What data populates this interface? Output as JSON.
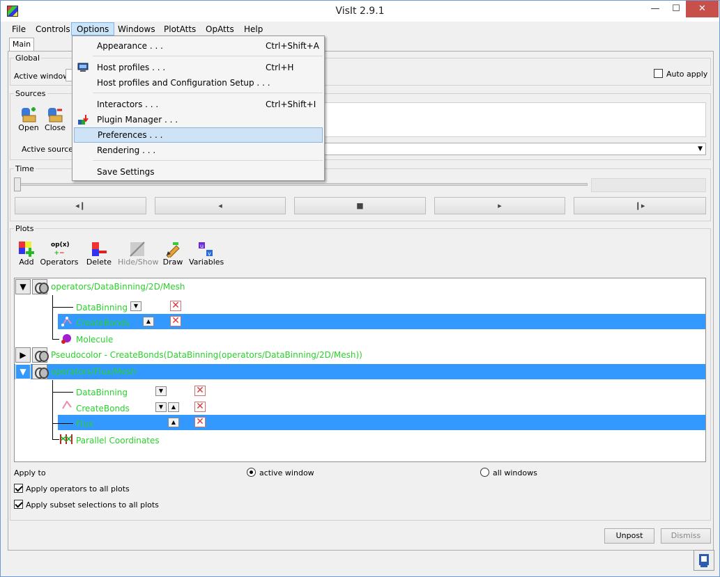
{
  "window": {
    "title": "VisIt 2.9.1",
    "minimize": "—",
    "maximize": "☐",
    "close": "✕"
  },
  "menubar": [
    "File",
    "Controls",
    "Options",
    "Windows",
    "PlotAtts",
    "OpAtts",
    "Help"
  ],
  "tabs": {
    "main": "Main"
  },
  "global": {
    "title": "Global",
    "active_window_label": "Active window",
    "auto_apply_label": "Auto apply",
    "auto_apply_checked": false
  },
  "sources": {
    "title": "Sources",
    "open_label": "Open",
    "close_label": "Close",
    "active_source_label": "Active source",
    "active_source_value": ""
  },
  "time": {
    "title": "Time",
    "controls": [
      "◂❙",
      "◂",
      "■",
      "▸",
      "❙▸"
    ]
  },
  "plots": {
    "title": "Plots",
    "toolbar": {
      "add": "Add",
      "operators": "Operators",
      "delete": "Delete",
      "hide_show": "Hide/Show",
      "draw": "Draw",
      "variables": "Variables",
      "operators_icon_text": "op(x)"
    },
    "items": [
      {
        "name": "operators/DataBinning/2D/Mesh",
        "expanded": true,
        "selected": false,
        "children": [
          "DataBinning",
          "CreateBonds",
          "Molecule"
        ]
      },
      {
        "name": "Pseudocolor - CreateBonds(DataBinning(operators/DataBinning/2D/Mesh))",
        "expanded": false,
        "selected": false
      },
      {
        "name": "operators/Flux/Mesh",
        "expanded": true,
        "selected": true,
        "children": [
          "DataBinning",
          "CreateBonds",
          "Flux",
          "Parallel Coordinates"
        ]
      }
    ]
  },
  "apply_to": {
    "label": "Apply to",
    "active_window": "active window",
    "all_windows": "all windows",
    "apply_operators": "Apply operators to all plots",
    "apply_subset": "Apply subset selections to all plots"
  },
  "buttons": {
    "unpost": "Unpost",
    "dismiss": "Dismiss"
  },
  "options_menu": [
    {
      "label": "Appearance . . .",
      "shortcut": "Ctrl+Shift+A"
    },
    {
      "label": "Host profiles . . .",
      "shortcut": "Ctrl+H"
    },
    {
      "label": "Host profiles and Configuration Setup . . .",
      "shortcut": ""
    },
    {
      "label": "Interactors . . .",
      "shortcut": "Ctrl+Shift+I"
    },
    {
      "label": "Plugin Manager . . .",
      "shortcut": ""
    },
    {
      "label": "Preferences . . .",
      "shortcut": ""
    },
    {
      "label": "Rendering . . .",
      "shortcut": ""
    },
    {
      "label": "Save Settings",
      "shortcut": ""
    }
  ],
  "colors": {
    "selection": "#3399ff",
    "plot_text": "#2ad12a",
    "menu_hover": "#cfe3f6"
  }
}
